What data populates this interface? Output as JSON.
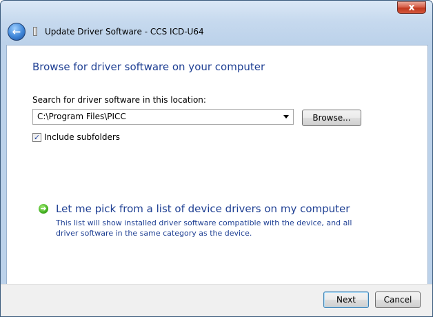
{
  "window": {
    "title": "Update Driver Software - CCS ICD-U64",
    "close_glyph": "x"
  },
  "nav": {
    "back_glyph": "←"
  },
  "main": {
    "heading": "Browse for driver software on your computer",
    "search_label": "Search for driver software in this location:",
    "path_value": "C:\\Program Files\\PICC",
    "browse_label": "Browse...",
    "include_subfolders_label": "Include subfolders",
    "include_subfolders_checked": true,
    "pick_link": "Let me pick from a list of device drivers on my computer",
    "pick_description": "This list will show installed driver software compatible with the device, and all driver software in the same category as the device."
  },
  "footer": {
    "next_label": "Next",
    "cancel_label": "Cancel"
  },
  "icons": {
    "back": "back-arrow-icon",
    "title": "device-icon",
    "close": "close-icon",
    "link": "green-arrow-icon",
    "combo": "chevron-down-icon"
  }
}
